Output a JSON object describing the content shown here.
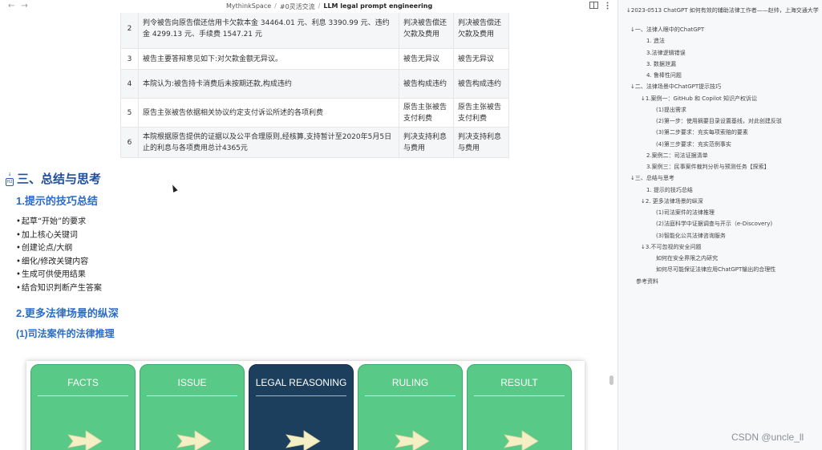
{
  "topbar": {
    "back": "←",
    "forward": "→",
    "breadcrumb": [
      "MythinkSpace",
      "#0灵活交流",
      "LLM legal prompt engineering"
    ],
    "separator": "/",
    "reading_mode_icon": "book-open-icon",
    "more_icon": "more-vertical-icon"
  },
  "table": {
    "rows": [
      {
        "num": "2",
        "content": "判令被告向原告偿还信用卡欠款本金 34464.01 元、利息 3390.99 元、违约金 4299.13 元、手续费 1547.21 元",
        "c3": "判决被告偿还欠款及费用",
        "c4": "判决被告偿还欠款及费用"
      },
      {
        "num": "3",
        "content": "被告主要答辩意见如下:对欠款金额无异议。",
        "c3": "被告无异议",
        "c4": "被告无异议"
      },
      {
        "num": "4",
        "content": "本院认为:被告持卡消费后未按期还款,构成违约",
        "c3": "被告构成违约",
        "c4": "被告构成违约"
      },
      {
        "num": "5",
        "content": "原告主张被告依据相关协议约定支付诉讼所述的各项利费",
        "c3": "原告主张被告支付利费",
        "c4": "原告主张被告支付利费"
      },
      {
        "num": "6",
        "content": "本院根据原告提供的证据以及公平合理原则,经核算,支持暂计至2020年5月5日止的利息与各项费用总计4365元",
        "c3": "判决支持利息与费用",
        "c4": "判决支持利息与费用"
      }
    ]
  },
  "section": {
    "h2_badge": "H2",
    "title": "三、总结与思考",
    "sub1": "1.提示的技巧总结",
    "bullets": [
      "起草“开始”的要求",
      "加上核心关键词",
      "创建论点/大纲",
      "细化/修改关键内容",
      "生成可供使用结果",
      "结合知识判断产生答案"
    ],
    "sub2": "2.更多法律场景的纵深",
    "sub2_1": "(1)司法案件的法律推理"
  },
  "diagram": {
    "steps": [
      {
        "label": "FACTS",
        "color": "#58c986"
      },
      {
        "label": "ISSUE",
        "color": "#58c986"
      },
      {
        "label": "LEGAL REASONING",
        "color": "#1d3f5e"
      },
      {
        "label": "RULING",
        "color": "#58c986"
      },
      {
        "label": "RESULT",
        "color": "#58c986"
      }
    ],
    "arrow_color": "#f4efc4"
  },
  "toc": {
    "title": "2023-0513 ChatGPT 如何有效的辅助法律工作者——赵帅，上海交通大学",
    "items": [
      {
        "text": "一、法律人眼中的ChatGPT",
        "level": 1,
        "arrow": true
      },
      {
        "text": "1. 造法",
        "level": 2,
        "arrow": false
      },
      {
        "text": "3.法律逻辑错误",
        "level": 2,
        "arrow": false
      },
      {
        "text": "3. 数据泄漏",
        "level": 2,
        "arrow": false
      },
      {
        "text": "4. 鲁棒性问题",
        "level": 2,
        "arrow": false
      },
      {
        "text": "二、法律场景中ChatGPT提示技巧",
        "level": 1,
        "arrow": true
      },
      {
        "text": "1.案例一：GitHub 和 Copilot 知识产权诉讼",
        "level": 2,
        "arrow": true
      },
      {
        "text": "(1)提出需求",
        "level": 3,
        "arrow": false
      },
      {
        "text": "(2)第一步：使用摘要目录设置基线，对此创建反驳",
        "level": 3,
        "arrow": false
      },
      {
        "text": "(3)第二步要求：充实每项索赔的要素",
        "level": 3,
        "arrow": false
      },
      {
        "text": "(4)第三步要求：充实范例事实",
        "level": 3,
        "arrow": false
      },
      {
        "text": "2.案例二：司法证据清单",
        "level": 2,
        "arrow": false
      },
      {
        "text": "3.案例三：民事案件裁判分析与预测任务【探索】",
        "level": 2,
        "arrow": false
      },
      {
        "text": "三、总结与思考",
        "level": 1,
        "arrow": true
      },
      {
        "text": "1. 提示的技巧总结",
        "level": 2,
        "arrow": false
      },
      {
        "text": "2. 更多法律场景的纵深",
        "level": 2,
        "arrow": true
      },
      {
        "text": "(1)司法案件的法律推理",
        "level": 3,
        "arrow": false
      },
      {
        "text": "(2)法庭科学中证据调查与开示（e-Discovery)",
        "level": 3,
        "arrow": false
      },
      {
        "text": "(3)智能化公共法律咨询服务",
        "level": 3,
        "arrow": false
      },
      {
        "text": "3.不可忽视的安全问题",
        "level": 2,
        "arrow": true
      },
      {
        "text": "如何在安全界限之内研究",
        "level": 3,
        "arrow": false
      },
      {
        "text": "如何尽可能保证法律应用ChatGPT输出的合理性",
        "level": 3,
        "arrow": false
      },
      {
        "text": "参考资料",
        "level": 0,
        "arrow": false
      }
    ]
  },
  "watermark": "CSDN @uncle_ll"
}
